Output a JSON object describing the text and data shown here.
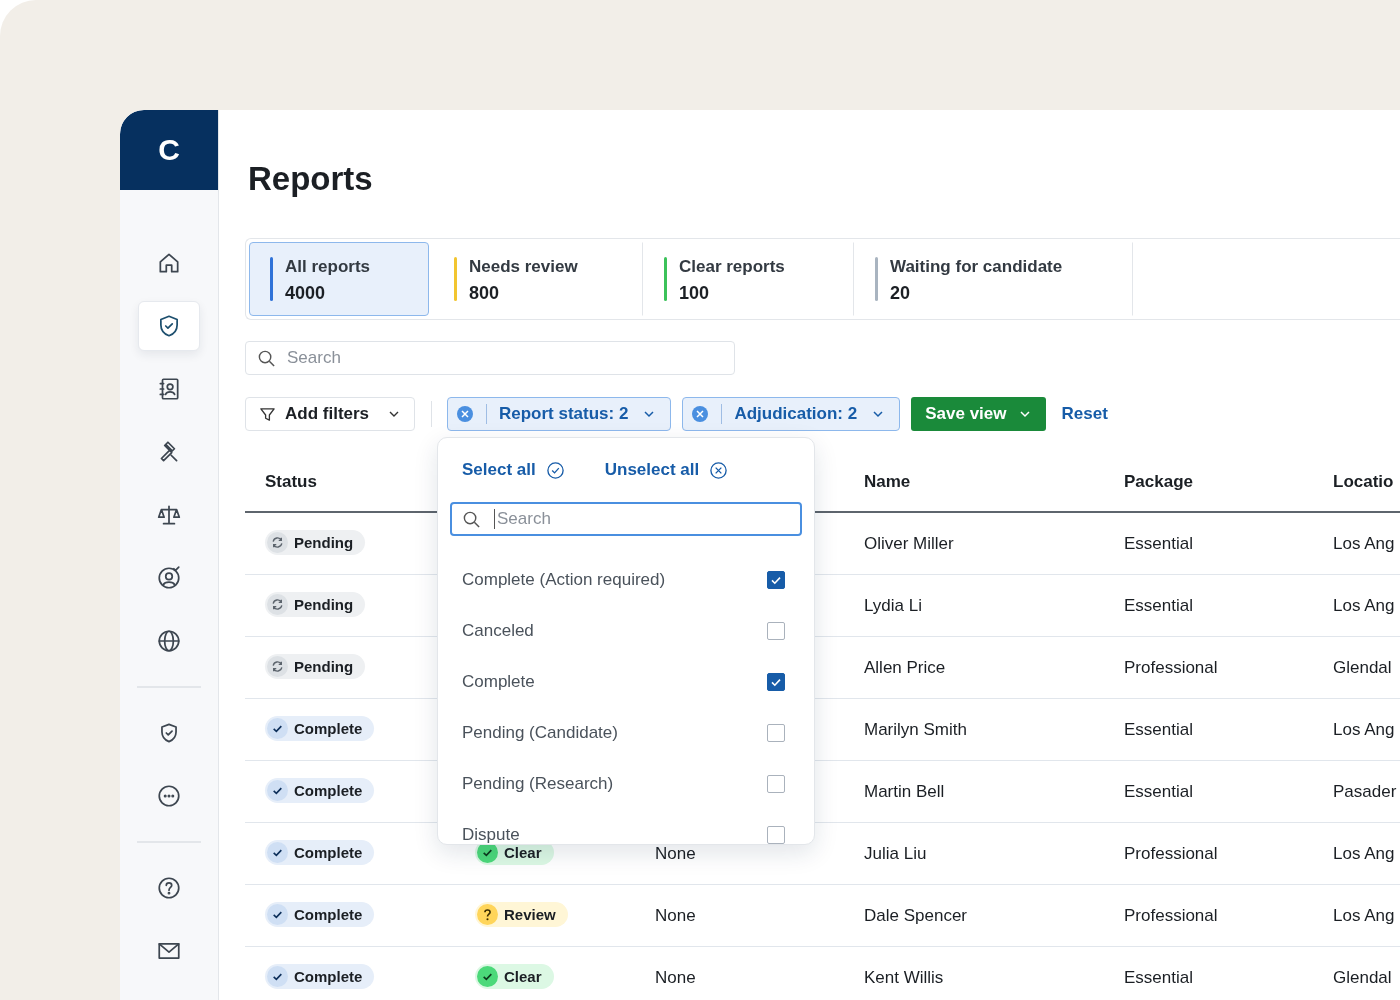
{
  "sidebar": {
    "logo": "C",
    "groups": [
      {
        "items": [
          {
            "selected": false
          },
          {
            "selected": true
          },
          {
            "selected": false
          },
          {
            "selected": false
          },
          {
            "selected": false
          },
          {
            "selected": false
          },
          {
            "selected": false
          }
        ]
      },
      {
        "items": [
          {
            "selected": false
          },
          {
            "selected": false
          }
        ]
      },
      {
        "items": [
          {
            "selected": false
          },
          {
            "selected": false
          }
        ]
      }
    ]
  },
  "page_title": "Reports",
  "tabs": [
    {
      "label": "All reports",
      "count": "4000",
      "color": "#2f72d8",
      "selected": true
    },
    {
      "label": "Needs review",
      "count": "800",
      "color": "#f2c530",
      "selected": false
    },
    {
      "label": "Clear reports",
      "count": "100",
      "color": "#3cc25a",
      "selected": false
    },
    {
      "label": "Waiting for candidate",
      "count": "20",
      "color": "#a9b4c0",
      "selected": false
    }
  ],
  "search": {
    "placeholder": "Search"
  },
  "filters": {
    "add_button": "Add filters",
    "chips": [
      {
        "label": "Report status: 2",
        "expanded": true
      },
      {
        "label": "Adjudication: 2",
        "expanded": false
      }
    ],
    "save_button": "Save view",
    "reset_link": "Reset"
  },
  "dropdown": {
    "select_all": "Select all",
    "unselect_all": "Unselect all",
    "search_placeholder": "Search",
    "options": [
      {
        "label": "Complete (Action required)",
        "checked": true
      },
      {
        "label": "Canceled",
        "checked": false
      },
      {
        "label": "Complete",
        "checked": true
      },
      {
        "label": "Pending (Candidate)",
        "checked": false
      },
      {
        "label": "Pending (Research)",
        "checked": false
      },
      {
        "label": "Dispute",
        "checked": false
      }
    ]
  },
  "table": {
    "columns": {
      "status": "Status",
      "name": "Name",
      "package": "Package",
      "location": "Locatio"
    },
    "rows": [
      {
        "status": {
          "kind": "pending",
          "label": "Pending"
        },
        "name": "Oliver Miller",
        "package": "Essential",
        "location": "Los Ang"
      },
      {
        "status": {
          "kind": "pending",
          "label": "Pending"
        },
        "name": "Lydia Li",
        "package": "Essential",
        "location": "Los Ang"
      },
      {
        "status": {
          "kind": "pending",
          "label": "Pending"
        },
        "name": "Allen Price",
        "package": "Professional",
        "location": "Glendal"
      },
      {
        "status": {
          "kind": "complete",
          "label": "Complete"
        },
        "name": "Marilyn Smith",
        "package": "Essential",
        "location": "Los Ang"
      },
      {
        "status": {
          "kind": "complete",
          "label": "Complete"
        },
        "name": "Martin Bell",
        "package": "Essential",
        "location": "Pasader"
      },
      {
        "status": {
          "kind": "complete",
          "label": "Complete"
        },
        "column_2": {
          "kind": "clear",
          "label": "Clear"
        },
        "column_3": "None",
        "name": "Julia Liu",
        "package": "Professional",
        "location": "Los Ang"
      },
      {
        "status": {
          "kind": "complete",
          "label": "Complete"
        },
        "column_2": {
          "kind": "review",
          "label": "Review"
        },
        "column_3": "None",
        "name": "Dale Spencer",
        "package": "Professional",
        "location": "Los Ang"
      },
      {
        "status": {
          "kind": "complete",
          "label": "Complete"
        },
        "column_2": {
          "kind": "clear",
          "label": "Clear"
        },
        "column_3": "None",
        "name": "Kent Willis",
        "package": "Essential",
        "location": "Glendal"
      }
    ]
  }
}
